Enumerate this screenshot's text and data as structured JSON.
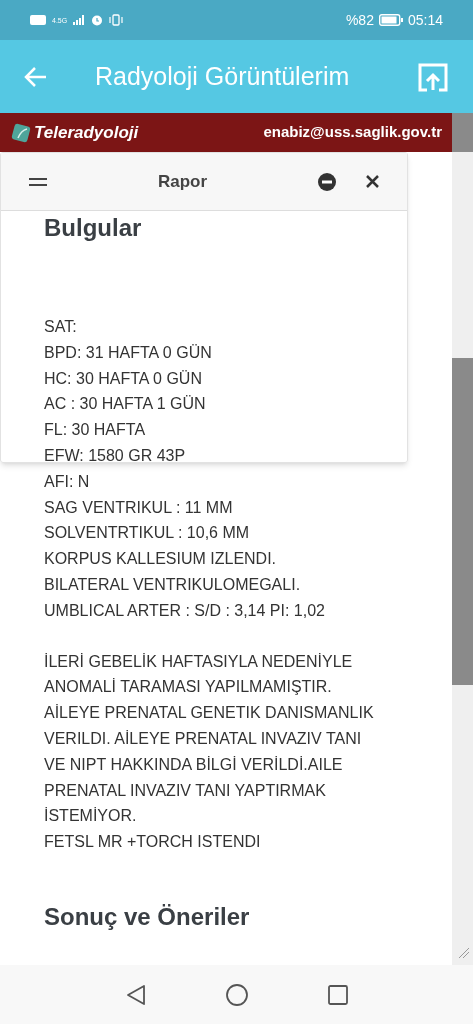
{
  "status_bar": {
    "battery_text": "%82",
    "time": "05:14",
    "network": "4.5G"
  },
  "app_bar": {
    "title": "Radyoloji Görüntülerim"
  },
  "banner": {
    "logo_text": "Teleradyoloji",
    "email": "enabiz@uss.saglik.gov.tr"
  },
  "dialog": {
    "title": "Rapor"
  },
  "report": {
    "heading": "Bulgular",
    "findings": [
      "SAT:",
      "BPD: 31 HAFTA 0 GÜN",
      "HC: 30 HAFTA 0 GÜN",
      "AC : 30 HAFTA 1 GÜN",
      "FL: 30 HAFTA",
      "EFW: 1580 GR 43P",
      "AFI: N",
      "SAG VENTRIKUL : 11 MM",
      "SOLVENTRTIKUL : 10,6 MM",
      "KORPUS KALLESIUM IZLENDI.",
      "BILATERAL VENTRIKULOMEGALI.",
      "UMBLICAL ARTER : S/D : 3,14 PI: 1,02"
    ],
    "notes": [
      "İLERİ GEBELİK HAFTASIYLA NEDENİYLE",
      "ANOMALİ TARAMASI YAPILMAMIŞTIR.",
      "AİLEYE PRENATAL GENETIK DANISMANLIK",
      "VERILDI. AİLEYE PRENATAL INVAZIV TANI",
      "VE NIPT HAKKINDA BİLGİ VERİLDİ.AILE",
      "PRENATAL INVAZIV TANI YAPTIRMAK",
      "İSTEMİYOR.",
      "FETSL MR +TORCH ISTENDI"
    ],
    "section_heading": "Sonuç ve Öneriler"
  }
}
